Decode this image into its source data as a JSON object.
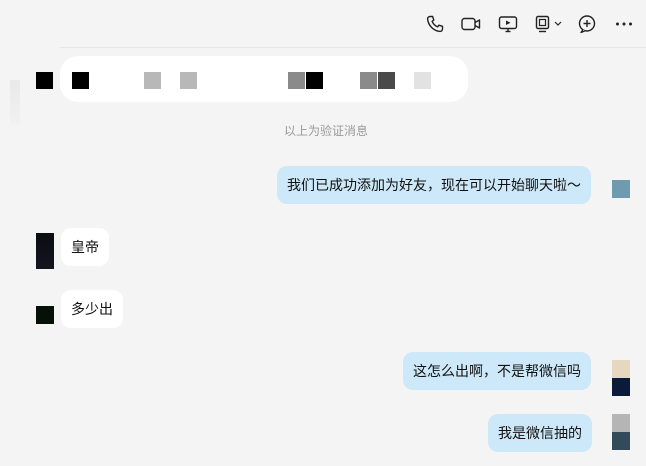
{
  "toolbar": {
    "icons": [
      "phone-icon",
      "video-call-icon",
      "screen-share-icon",
      "remote-assist-icon",
      "add-member-icon",
      "more-icon"
    ]
  },
  "verification": {
    "note": "以上为验证消息"
  },
  "messages": [
    {
      "direction": "out",
      "text": "我们已成功添加为好友，现在可以开始聊天啦～"
    },
    {
      "direction": "in",
      "text": "皇帝"
    },
    {
      "direction": "in",
      "text": "多少出"
    },
    {
      "direction": "out",
      "text": "这怎么出啊，不是帮微信吗"
    },
    {
      "direction": "out",
      "text": "我是微信抽的"
    }
  ],
  "colors": {
    "background": "#f4f4f4",
    "incoming_bubble": "#ffffff",
    "outgoing_bubble": "#cde8f8",
    "note_text": "#9a9a9a"
  }
}
